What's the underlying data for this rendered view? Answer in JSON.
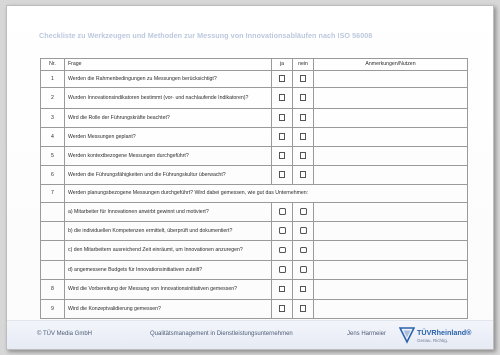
{
  "title": "Checkliste zu Werkzeugen und Methoden zur Messung von Innovationsabläufen nach ISO 56008",
  "table": {
    "headers": {
      "nr": "Nr.",
      "frage": "Frage",
      "ja": "ja",
      "nein": "nein",
      "notes": "Anmerkungen/Nutzen"
    },
    "rows": [
      {
        "nr": "1",
        "frage": "Werden die Rahmenbedingungen zu Messungen berücksichtigt?"
      },
      {
        "nr": "2",
        "frage": "Wurden Innovationsindikatoren bestimmt (vor- und nachlaufende Indikatoren)?"
      },
      {
        "nr": "3",
        "frage": "Wird die Rolle der Führungskräfte beachtet?"
      },
      {
        "nr": "4",
        "frage": "Werden Messungen geplant?"
      },
      {
        "nr": "5",
        "frage": "Werden kontextbezogene Messungen durchgeführt?"
      },
      {
        "nr": "6",
        "frage": "Werden die Führungsfähigkeiten und die Führungskultur überwacht?"
      },
      {
        "nr": "7",
        "frage": "Werden planungsbezogene Messungen durchgeführt? Wird dabei gemessen, wie gut das Unternehmen:"
      }
    ],
    "subrows": [
      "a) Mitarbeiter für Innovationen anwirbt gewinnt und motiviert?",
      "b) die individuellen Kompetenzen ermittelt, überprüft und dokumentiert?",
      "c) den Mitarbeitern ausreichend Zeit einräumt, um Innovationen anzuregen?",
      "d) angemessene Budgets für Innovationsinitiativen zuteilt?"
    ],
    "rows_after": [
      {
        "nr": "8",
        "frage": "Wird die Vorbereitung der Messung von Innovationsinitiativen gemessen?"
      },
      {
        "nr": "9",
        "frage": "Wird die Konzeptvalidierung gemessen?"
      }
    ]
  },
  "footer": {
    "copyright": "© TÜV Media GmbH",
    "subject": "Qualitätsmanagement in Dienstleistungsunternehmen",
    "author": "Jens Harmeier",
    "brand": "TÜVRheinland®",
    "brand_tagline": "Genau. Richtig."
  },
  "colors": {
    "title": "#bcc8dd",
    "footer_bg": "#e9ecf5",
    "brand_blue": "#2a62ad"
  }
}
